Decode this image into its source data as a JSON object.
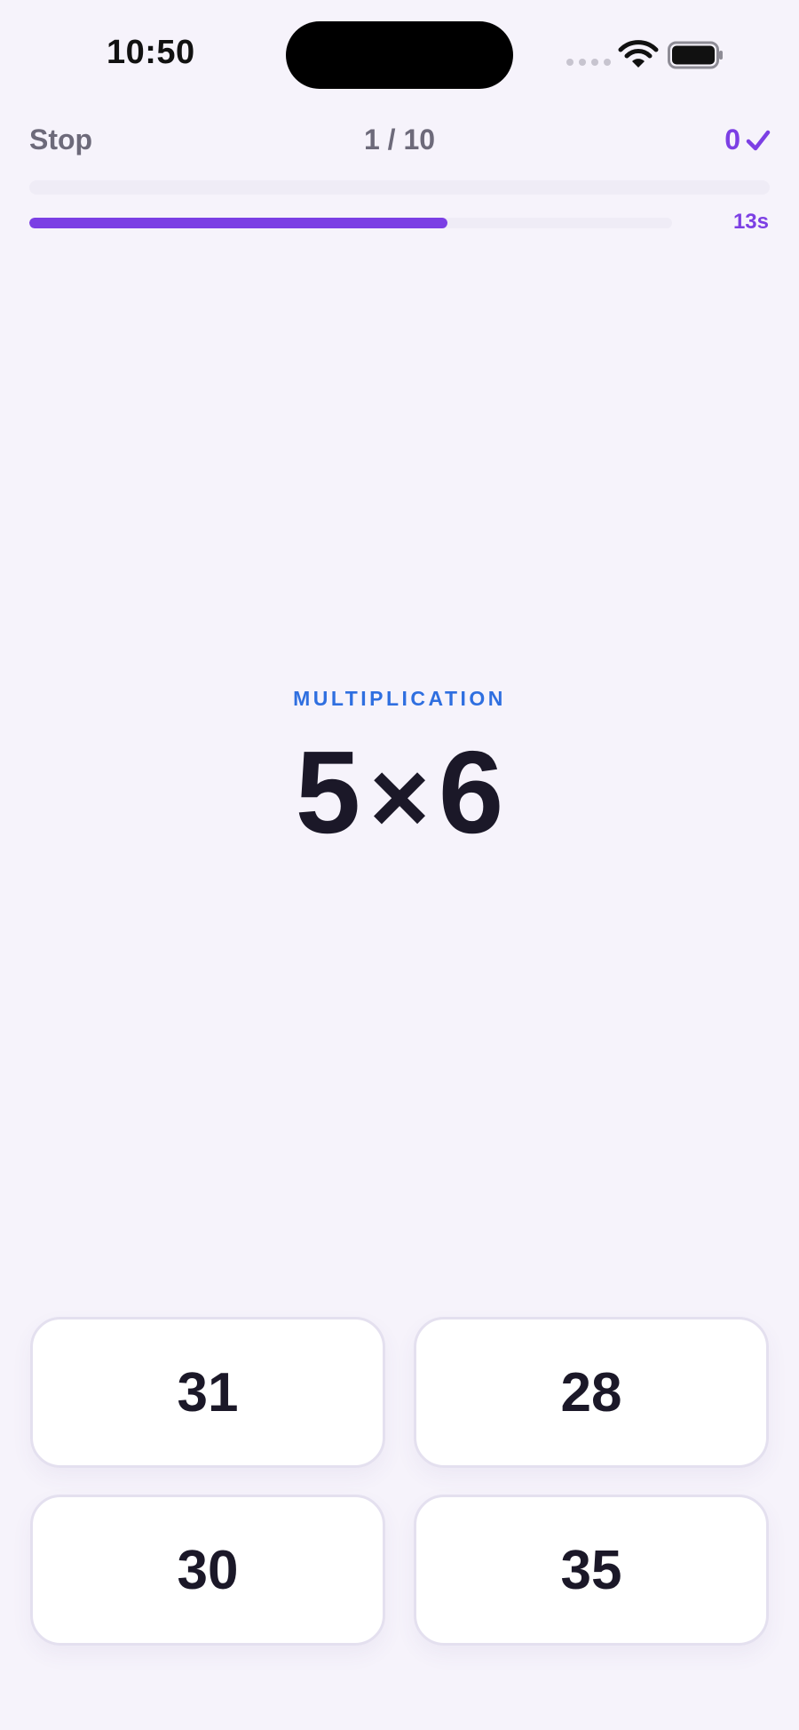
{
  "status_bar": {
    "time": "10:50",
    "icons": [
      "cellular-signal-icon",
      "wifi-icon",
      "battery-icon"
    ]
  },
  "header": {
    "stop_label": "Stop",
    "progress_text": "1 / 10",
    "score": "0",
    "score_icon": "checkmark-icon",
    "session_progress": 0.0,
    "timer_label": "13s",
    "timer_fraction": 0.65
  },
  "question": {
    "category": "MULTIPLICATION",
    "operand_a": "5",
    "operator": "×",
    "operand_b": "6"
  },
  "answers": [
    "31",
    "28",
    "30",
    "35"
  ],
  "colors": {
    "accent": "#7c3fe4",
    "category": "#2f6fe0",
    "background": "#f6f3fb",
    "text_primary": "#1b1828",
    "text_secondary": "#6d6a7a"
  }
}
